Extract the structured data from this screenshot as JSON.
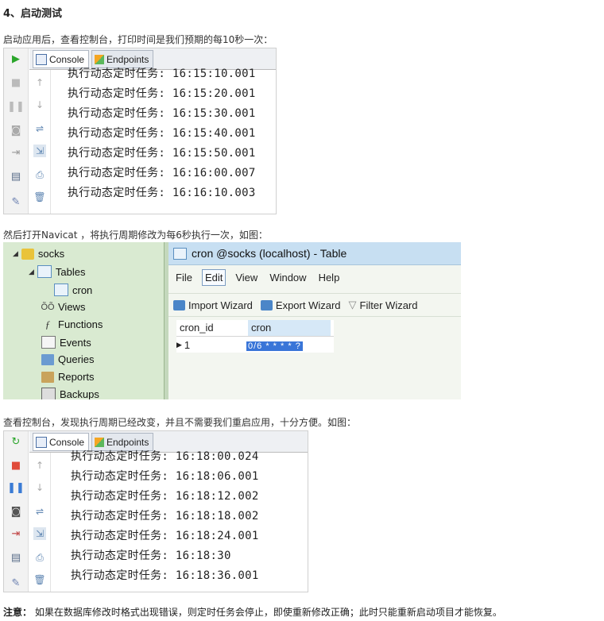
{
  "heading": "4、启动测试",
  "para1": "启动应用后，查看控制台，打印时间是我们预期的每10秒一次：",
  "console1": {
    "tab_console": "Console",
    "tab_endpoints": "Endpoints",
    "lines": [
      "执行动态定时任务: 16:15:10.001",
      "执行动态定时任务: 16:15:20.001",
      "执行动态定时任务: 16:15:30.001",
      "执行动态定时任务: 16:15:40.001",
      "执行动态定时任务: 16:15:50.001",
      "执行动态定时任务: 16:16:00.007",
      "执行动态定时任务: 16:16:10.003"
    ]
  },
  "para2": "然后打开Navicat ，将执行周期修改为每6秒执行一次，如图：",
  "navicat": {
    "tree": {
      "db": "socks",
      "tables": "Tables",
      "table_cron": "cron",
      "views": "Views",
      "functions": "Functions",
      "events": "Events",
      "queries": "Queries",
      "reports": "Reports",
      "backups": "Backups"
    },
    "window_title": "cron @socks (localhost) - Table",
    "menu": [
      "File",
      "Edit",
      "View",
      "Window",
      "Help"
    ],
    "toolbar": {
      "import": "Import Wizard",
      "export": "Export Wizard",
      "filter": "Filter Wizard"
    },
    "grid": {
      "col1": "cron_id",
      "col2": "cron",
      "row_id": "1",
      "row_cron": "0/6 * * * * ?"
    }
  },
  "para3": "查看控制台，发现执行周期已经改变，并且不需要我们重启应用，十分方便。如图：",
  "console2": {
    "tab_console": "Console",
    "tab_endpoints": "Endpoints",
    "lines": [
      "执行动态定时任务: 16:18:00.024",
      "执行动态定时任务: 16:18:06.001",
      "执行动态定时任务: 16:18:12.002",
      "执行动态定时任务: 16:18:18.002",
      "执行动态定时任务: 16:18:24.001",
      "执行动态定时任务: 16:18:30",
      "执行动态定时任务: 16:18:36.001"
    ]
  },
  "note_label": "注意：",
  "note_text": " 如果在数据库修改时格式出现错误，则定时任务会停止，即使重新修改正确；此时只能重新启动项目才能恢复。",
  "colors": {
    "selection": "#3975d8",
    "navicat_bg": "#d9ead1",
    "title_bar": "#c7dff2"
  }
}
